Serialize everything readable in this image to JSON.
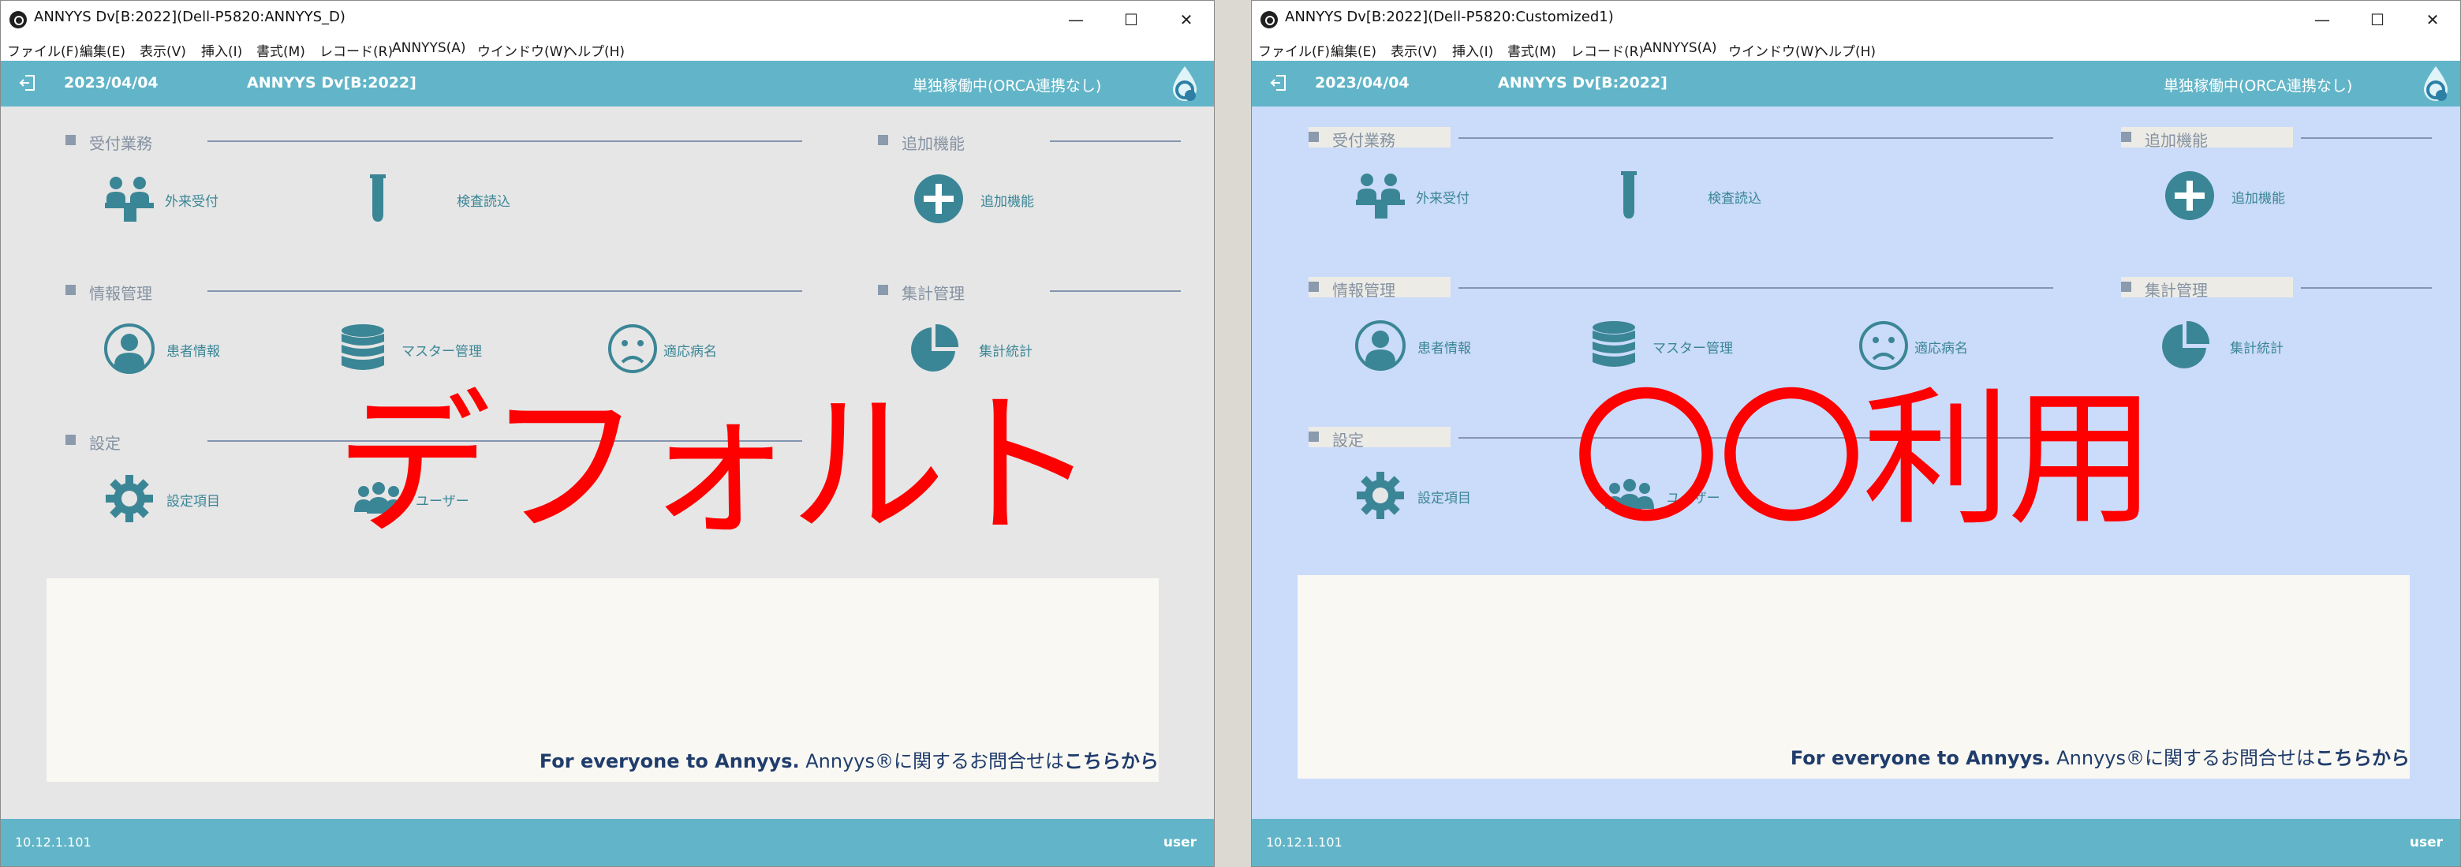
{
  "colors": {
    "accent": "#62b5c8",
    "icon": "#3b8696",
    "overlay": "#ff0000",
    "panel": "#faf8f3",
    "bg_default": "#e6e6e6",
    "bg_custom": "#cbdbfa"
  },
  "menu": [
    "ファイル(F)",
    "編集(E)",
    "表示(V)",
    "挿入(I)",
    "書式(M)",
    "レコード(R)",
    "ANNYYS(A)",
    "ウインドウ(W)",
    "ヘルプ(H)"
  ],
  "sections": {
    "reception": "受付業務",
    "additional": "追加機能",
    "info": "情報管理",
    "stats": "集計管理",
    "settings": "設定"
  },
  "items": {
    "outpatient": "外来受付",
    "lab_import": "検査読込",
    "add_feature": "追加機能",
    "patient_info": "患者情報",
    "master": "マスター管理",
    "disease": "適応病名",
    "statistics": "集計統計",
    "setting_items": "設定項目",
    "users": "ユーザー"
  },
  "icons": {
    "outpatient": "reception-desk-icon",
    "lab_import": "test-tube-icon",
    "add_feature": "plus-circle-icon",
    "patient_info": "person-icon",
    "master": "database-icon",
    "disease": "sad-face-icon",
    "statistics": "pie-chart-icon",
    "setting_items": "gear-icon",
    "users": "users-icon"
  },
  "info": {
    "bold": "For everyone to Annyys.",
    "middle": " Annyys®に関するお問合せは",
    "link": "こちらから"
  },
  "windows": {
    "default": {
      "title": "ANNYYS Dv[B:2022](Dell-P5820:ANNYYS_D)",
      "date": "2023/04/04",
      "app_title": "ANNYYS Dv[B:2022]",
      "status": "単独稼働中(ORCA連携なし)",
      "version": "10.12.1.101",
      "user": "user",
      "overlay": "デフォルト"
    },
    "custom": {
      "title": "ANNYYS Dv[B:2022](Dell-P5820:Customized1)",
      "date": "2023/04/04",
      "app_title": "ANNYYS Dv[B:2022]",
      "status": "単独稼働中(ORCA連携なし)",
      "version": "10.12.1.101",
      "user": "user",
      "overlay": "〇〇利用"
    }
  }
}
